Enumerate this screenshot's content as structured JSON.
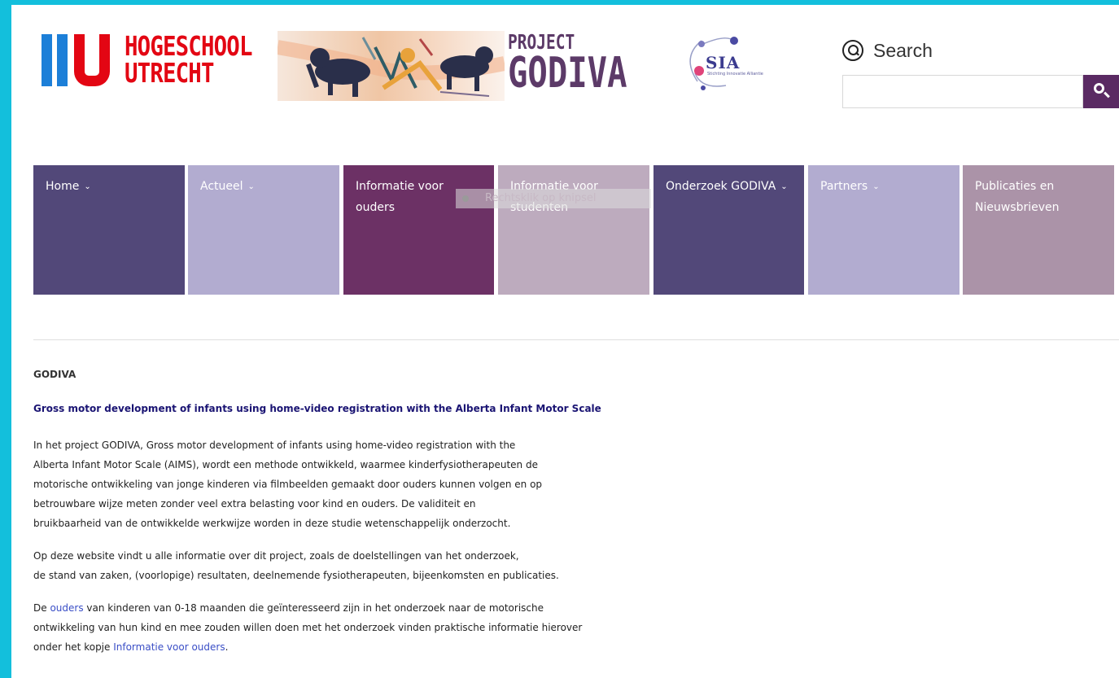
{
  "header": {
    "logo_text_line1": "HOGESCHOOL",
    "logo_text_line2": "UTRECHT",
    "project_line1": "PROJECT",
    "project_line2": "GODIVA",
    "sia_text": "SIA",
    "sia_subtitle": "Stichting Innovatie Alliantie"
  },
  "search": {
    "label": "Search",
    "placeholder": "",
    "value": "",
    "button_icon": "search-icon"
  },
  "nav": {
    "items": [
      {
        "label": "Home",
        "has_dropdown": true,
        "color": "#524879"
      },
      {
        "label": "Actueel",
        "has_dropdown": true,
        "color": "#b2acd0"
      },
      {
        "label": "Informatie voor ouders",
        "has_dropdown": false,
        "color": "#6c3165"
      },
      {
        "label": "Informatie voor studenten",
        "has_dropdown": false,
        "color": "#bdabbe"
      },
      {
        "label": "Onderzoek GODIVA",
        "has_dropdown": true,
        "color": "#524879"
      },
      {
        "label": "Partners",
        "has_dropdown": true,
        "color": "#b2acd0"
      },
      {
        "label": "Publicaties en Nieuwsbrieven",
        "has_dropdown": false,
        "color": "#ab93a8"
      }
    ],
    "dropdown_caret": "⌄",
    "tooltip": "Rechtsklik op knipsel"
  },
  "content": {
    "title": "GODIVA",
    "subtitle": "Gross motor development of infants using home-video registration with the Alberta Infant Motor Scale",
    "para1": [
      "In het project GODIVA, Gross motor development of infants using home-video registration with the",
      "Alberta Infant Motor Scale (AIMS), wordt een methode ontwikkeld, waarmee kinderfysiotherapeuten de",
      "motorische ontwikkeling van jonge kinderen via filmbeelden gemaakt door ouders kunnen volgen en op",
      "betrouwbare wijze meten zonder veel extra belasting voor kind en ouders. De validiteit en",
      "bruikbaarheid van de ontwikkelde werkwijze worden in deze studie wetenschappelijk onderzocht."
    ],
    "para2": [
      "Op deze website vindt u alle informatie over dit project, zoals  de doelstellingen van het onderzoek,",
      "de stand van zaken, (voorlopige) resultaten, deelnemende fysiotherapeuten, bijeenkomsten en publicaties."
    ],
    "para3": {
      "line1_pre": "De ",
      "line1_link": "ouders",
      "line1_post": " van kinderen van 0-18 maanden die geïnteresseerd zijn in het onderzoek naar de motorische",
      "line2": "ontwikkeling van hun kind en mee zouden willen doen met het onderzoek vinden praktische informatie hierover",
      "line3_pre": "onder het kopje ",
      "line3_link": "Informatie voor ouders",
      "line3_post": "."
    }
  },
  "colors": {
    "frame": "#13bfdc",
    "accent": "#5a2a63",
    "logo_red": "#e30613",
    "logo_blue": "#1c7fd8",
    "subtitle_blue": "#1a1473",
    "link": "#3a4ec6"
  }
}
